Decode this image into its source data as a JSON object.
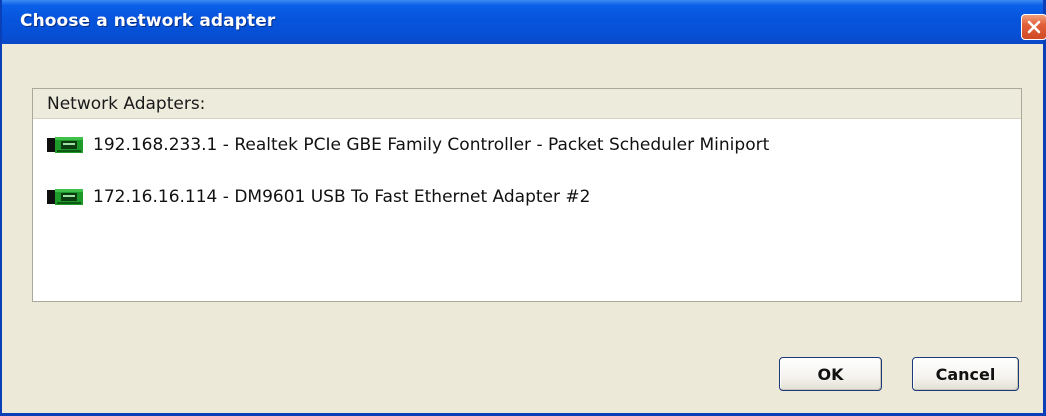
{
  "window": {
    "title": "Choose a network adapter"
  },
  "panel": {
    "header": "Network Adapters:"
  },
  "adapters": [
    {
      "label": "192.168.233.1 - Realtek PCIe GBE Family Controller - Packet Scheduler Miniport",
      "icon": "network-card-icon"
    },
    {
      "label": "172.16.16.114 - DM9601 USB To Fast Ethernet Adapter #2",
      "icon": "network-card-icon"
    }
  ],
  "buttons": {
    "ok_label": "OK",
    "cancel_label": "Cancel"
  },
  "colors": {
    "titlebar": "#0754dc",
    "close_button": "#d04a24",
    "dialog_background": "#ece9d8",
    "icon_green": "#1e9a2a"
  }
}
